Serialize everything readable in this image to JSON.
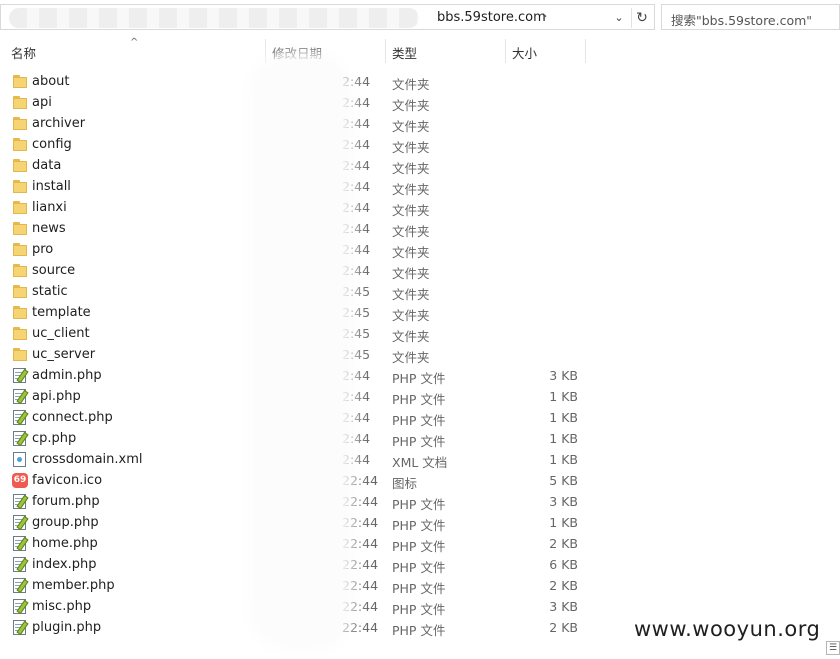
{
  "address": {
    "path": "bbs.59store.com",
    "chevron": "›",
    "dropdown": "⌄",
    "refresh": "↻"
  },
  "search": {
    "placeholder": "搜索\"bbs.59store.com\""
  },
  "columns": {
    "name": "名称",
    "modified": "修改日期",
    "type": "类型",
    "size": "大小",
    "sort_arrow": "^"
  },
  "files": [
    {
      "name": "about",
      "date": "2:44",
      "type": "文件夹",
      "size": "",
      "icon": "folder-icon"
    },
    {
      "name": "api",
      "date": "2:44",
      "type": "文件夹",
      "size": "",
      "icon": "folder-icon"
    },
    {
      "name": "archiver",
      "date": "2:44",
      "type": "文件夹",
      "size": "",
      "icon": "folder-icon"
    },
    {
      "name": "config",
      "date": "2:44",
      "type": "文件夹",
      "size": "",
      "icon": "folder-icon"
    },
    {
      "name": "data",
      "date": "2:44",
      "type": "文件夹",
      "size": "",
      "icon": "folder-icon"
    },
    {
      "name": "install",
      "date": "2:44",
      "type": "文件夹",
      "size": "",
      "icon": "folder-icon"
    },
    {
      "name": "lianxi",
      "date": "2:44",
      "type": "文件夹",
      "size": "",
      "icon": "folder-icon"
    },
    {
      "name": "news",
      "date": "2:44",
      "type": "文件夹",
      "size": "",
      "icon": "folder-icon"
    },
    {
      "name": "pro",
      "date": "2:44",
      "type": "文件夹",
      "size": "",
      "icon": "folder-icon"
    },
    {
      "name": "source",
      "date": "2:44",
      "type": "文件夹",
      "size": "",
      "icon": "folder-icon"
    },
    {
      "name": "static",
      "date": "2:45",
      "type": "文件夹",
      "size": "",
      "icon": "folder-icon"
    },
    {
      "name": "template",
      "date": "2:45",
      "type": "文件夹",
      "size": "",
      "icon": "folder-icon"
    },
    {
      "name": "uc_client",
      "date": "2:45",
      "type": "文件夹",
      "size": "",
      "icon": "folder-icon"
    },
    {
      "name": "uc_server",
      "date": "2:45",
      "type": "文件夹",
      "size": "",
      "icon": "folder-icon"
    },
    {
      "name": "admin.php",
      "date": "2:44",
      "type": "PHP 文件",
      "size": "3 KB",
      "icon": "php-file-icon"
    },
    {
      "name": "api.php",
      "date": "2:44",
      "type": "PHP 文件",
      "size": "1 KB",
      "icon": "php-file-icon"
    },
    {
      "name": "connect.php",
      "date": "2:44",
      "type": "PHP 文件",
      "size": "1 KB",
      "icon": "php-file-icon"
    },
    {
      "name": "cp.php",
      "date": "2:44",
      "type": "PHP 文件",
      "size": "1 KB",
      "icon": "php-file-icon"
    },
    {
      "name": "crossdomain.xml",
      "date": "2:44",
      "type": "XML 文档",
      "size": "1 KB",
      "icon": "xml-file-icon"
    },
    {
      "name": "favicon.ico",
      "date": "22:44",
      "type": "图标",
      "size": "5 KB",
      "icon": "ico-file-icon"
    },
    {
      "name": "forum.php",
      "date": "22:44",
      "type": "PHP 文件",
      "size": "3 KB",
      "icon": "php-file-icon"
    },
    {
      "name": "group.php",
      "date": "22:44",
      "type": "PHP 文件",
      "size": "1 KB",
      "icon": "php-file-icon"
    },
    {
      "name": "home.php",
      "date": "22:44",
      "type": "PHP 文件",
      "size": "2 KB",
      "icon": "php-file-icon"
    },
    {
      "name": "index.php",
      "date": "22:44",
      "type": "PHP 文件",
      "size": "6 KB",
      "icon": "php-file-icon"
    },
    {
      "name": "member.php",
      "date": "22:44",
      "type": "PHP 文件",
      "size": "2 KB",
      "icon": "php-file-icon"
    },
    {
      "name": "misc.php",
      "date": "22:44",
      "type": "PHP 文件",
      "size": "3 KB",
      "icon": "php-file-icon"
    },
    {
      "name": "plugin.php",
      "date": "22:44",
      "type": "PHP 文件",
      "size": "2 KB",
      "icon": "php-file-icon"
    }
  ],
  "watermark": "www.wooyun.org",
  "corner_glyph": "☰"
}
